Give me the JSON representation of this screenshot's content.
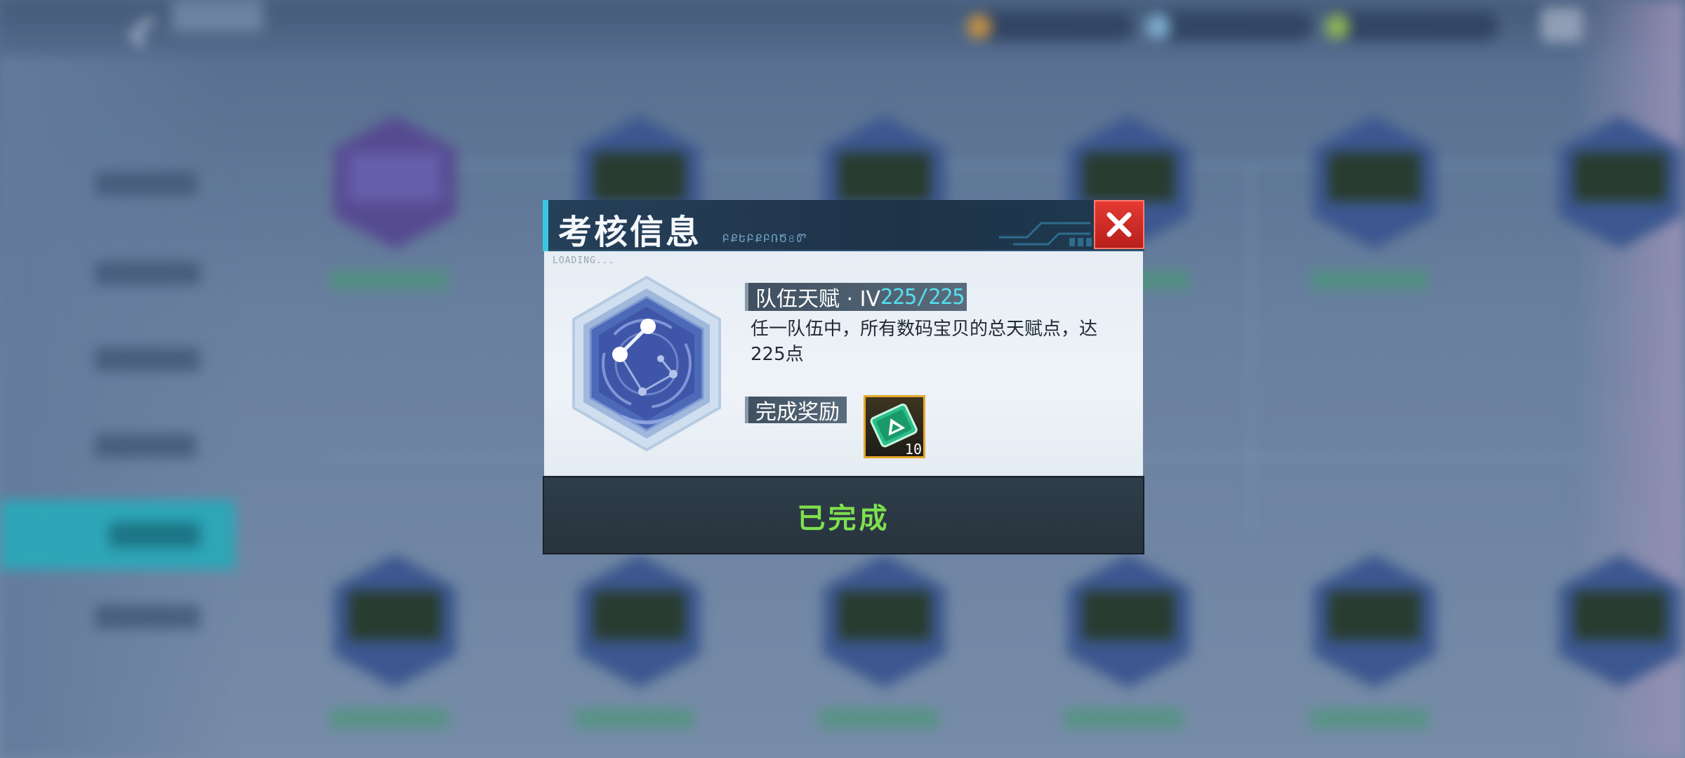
{
  "dialog": {
    "title": "考核信息",
    "title_deco": "ԲՔԵԲՔԲՌԾ৪Ꮫ",
    "loading": "LOADING...",
    "task_name": "队伍天赋 · IV",
    "task_progress": "225/225",
    "description": "任一队伍中，所有数码宝贝的总天赋点，达225点",
    "reward_label": "完成奖励",
    "reward_count": "10",
    "status": "已完成"
  },
  "colors": {
    "accent_cyan": "#39c7dd",
    "progress_text": "#56dfee",
    "close_red": "#d42e28",
    "status_green": "#7ee04e",
    "reward_gold": "#e6a72b"
  },
  "icons": {
    "close": "close-icon",
    "badge": "constellation-badge-icon",
    "reward": "ticket-icon",
    "back": "back-arrow-icon"
  }
}
